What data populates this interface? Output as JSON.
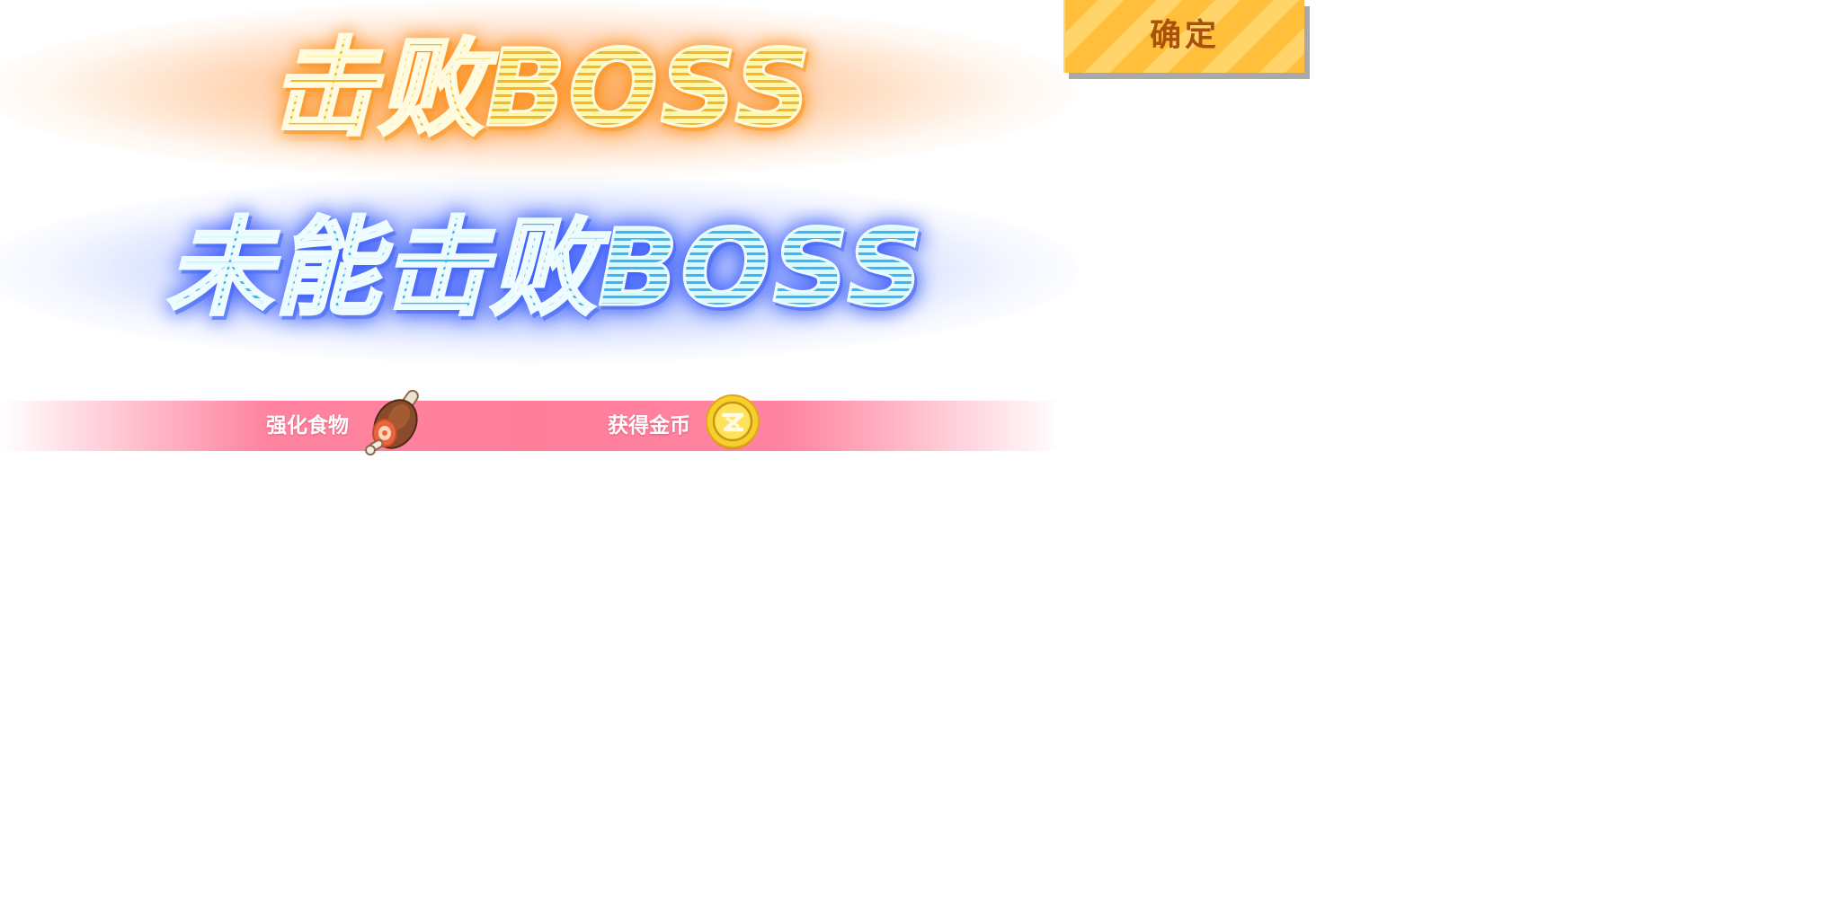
{
  "victory_title": "击败BOSS",
  "defeat_title": "未能击败BOSS",
  "rewards": {
    "food_label": "强化食物",
    "gold_label": "获得金币",
    "food_icon": "meat-icon",
    "gold_icon": "gold-coin-icon"
  },
  "confirm_button": {
    "label": "确定"
  },
  "colors": {
    "victory_glow": "#ff9a3c",
    "victory_text": "#fff7a8",
    "defeat_glow": "#5a78ff",
    "defeat_text": "#3fb4f6",
    "reward_strip": "#ff7f9b",
    "button_fill": "#ffbf3a",
    "button_text": "#a8500c"
  }
}
